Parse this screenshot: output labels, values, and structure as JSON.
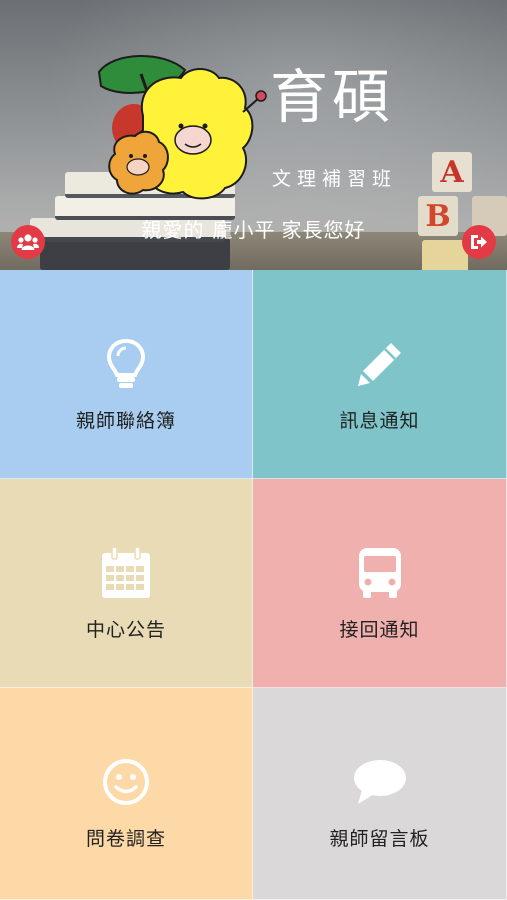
{
  "header": {
    "brand_title": "育碩",
    "brand_subtitle": "文理補習班",
    "greeting_prefix": "親愛的",
    "greeting_name": "龐小平",
    "greeting_suffix": "家長您好",
    "left_button_icon": "users-icon",
    "right_button_icon": "sign-out-icon",
    "accent_color": "#e23b45",
    "blocks": [
      "A",
      "B"
    ]
  },
  "menu": {
    "tiles": [
      {
        "label": "親師聯絡簿",
        "icon": "lightbulb-icon",
        "color": "#a8cdf0"
      },
      {
        "label": "訊息通知",
        "icon": "pencil-icon",
        "color": "#7ec4c8"
      },
      {
        "label": "中心公告",
        "icon": "calendar-icon",
        "color": "#e8dbb5"
      },
      {
        "label": "接回通知",
        "icon": "bus-icon",
        "color": "#f0b0ae"
      },
      {
        "label": "問卷調查",
        "icon": "smiley-icon",
        "color": "#fcd9a6"
      },
      {
        "label": "親師留言板",
        "icon": "chat-bubble-icon",
        "color": "#dbd8da"
      }
    ]
  }
}
